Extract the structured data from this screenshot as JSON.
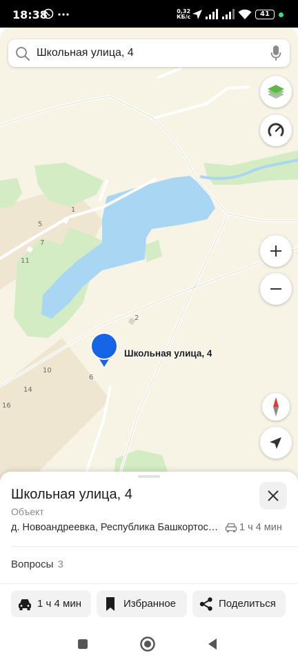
{
  "status_bar": {
    "time": "18:38",
    "network_speed_value": "0,32",
    "network_speed_unit": "КБ/с",
    "battery": "41"
  },
  "search": {
    "query": "Школьная улица, 4"
  },
  "map": {
    "house_numbers": [
      "1",
      "5",
      "7",
      "11",
      "2",
      "10",
      "6",
      "14",
      "16"
    ],
    "pin_label": "Школьная улица, 4"
  },
  "place": {
    "title": "Школьная улица, 4",
    "type": "Объект",
    "address": "д. Новоандреевка, Республика Башкортостан",
    "eta": "1 ч 4 мин",
    "questions_label": "Вопросы",
    "questions_count": "3"
  },
  "actions": {
    "route_label": "1 ч 4 мин",
    "favorites_label": "Избранное",
    "share_label": "Поделиться"
  },
  "colors": {
    "water": "#a9d6f2",
    "greenery": "#d4ecc4",
    "land": "#f7f4e6",
    "pin": "#1565e6",
    "compass_red": "#e53935"
  }
}
